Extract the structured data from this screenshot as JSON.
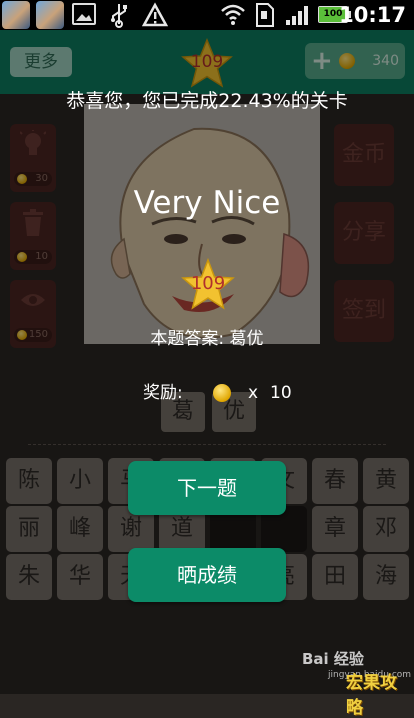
{
  "status_bar": {
    "time": "10:17",
    "battery": "100",
    "icons": [
      "game-app-icon",
      "game-app-icon",
      "image-icon",
      "usb-icon",
      "warning-icon",
      "wifi-icon",
      "sim-icon",
      "signal-icon",
      "battery-icon"
    ]
  },
  "top_bar": {
    "more_label": "更多",
    "level": "109",
    "coins": "340"
  },
  "side_left": [
    {
      "icon": "lightbulb-icon",
      "cost": "30"
    },
    {
      "icon": "trash-icon",
      "cost": "10"
    },
    {
      "icon": "eye-icon",
      "cost": "150"
    }
  ],
  "side_right": [
    "金币",
    "分享",
    "签到"
  ],
  "answer_slots": [
    "葛",
    "优"
  ],
  "letter_grid": [
    [
      "陈",
      "小",
      "马",
      "",
      "",
      "文",
      "春",
      "黄"
    ],
    [
      "丽",
      "峰",
      "谢",
      "道",
      "",
      "",
      "章",
      "邓"
    ],
    [
      "朱",
      "华",
      "天",
      "",
      "",
      "亮",
      "田",
      "海"
    ]
  ],
  "overlay": {
    "congrats_text": "恭喜您，您已完成22.43%的关卡",
    "headline": "Very Nice",
    "level": "109",
    "answer_text": "本题答案: 葛优",
    "reward_label": "奖励:",
    "reward_times": "x",
    "reward_value": "10",
    "next_button": "下一题",
    "share_button": "晒成绩"
  },
  "watermark": {
    "brand": "Bai 经验",
    "sub": "jingyan.baidu.com",
    "site": "宏果攻略"
  },
  "colors": {
    "brand_green": "#0d7d5f",
    "button_green": "#0c8b68",
    "star_gold": "#f2c230",
    "coin_gold": "#e0a600"
  }
}
